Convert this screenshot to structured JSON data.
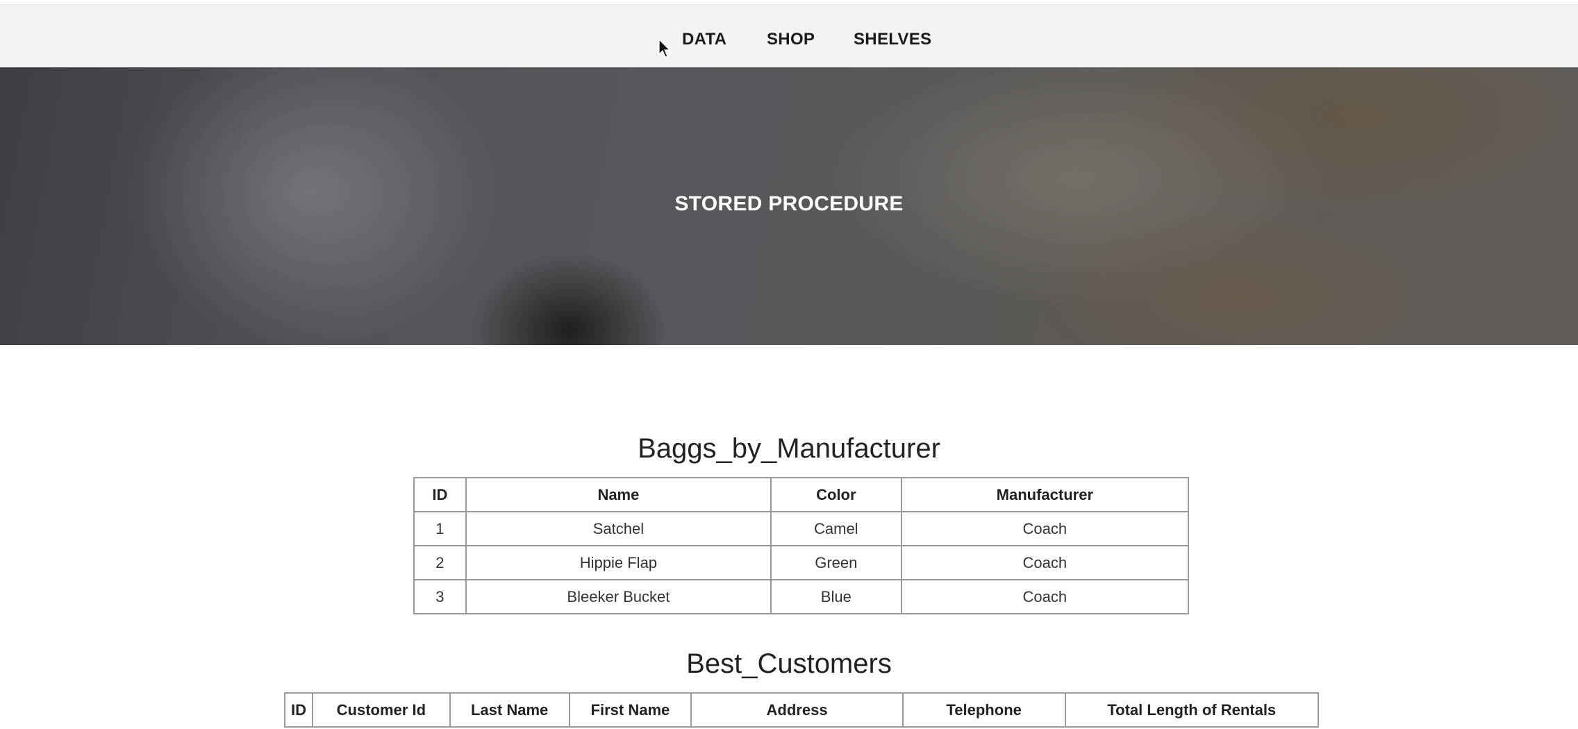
{
  "nav": {
    "items": [
      "DATA",
      "SHOP",
      "SHELVES"
    ]
  },
  "hero": {
    "title": "STORED PROCEDURE"
  },
  "baggs": {
    "title": "Baggs_by_Manufacturer",
    "headers": [
      "ID",
      "Name",
      "Color",
      "Manufacturer"
    ],
    "rows": [
      [
        "1",
        "Satchel",
        "Camel",
        "Coach"
      ],
      [
        "2",
        "Hippie Flap",
        "Green",
        "Coach"
      ],
      [
        "3",
        "Bleeker Bucket",
        "Blue",
        "Coach"
      ]
    ]
  },
  "customers": {
    "title": "Best_Customers",
    "headers": [
      "ID",
      "Customer Id",
      "Last Name",
      "First Name",
      "Address",
      "Telephone",
      "Total Length of Rentals"
    ]
  }
}
